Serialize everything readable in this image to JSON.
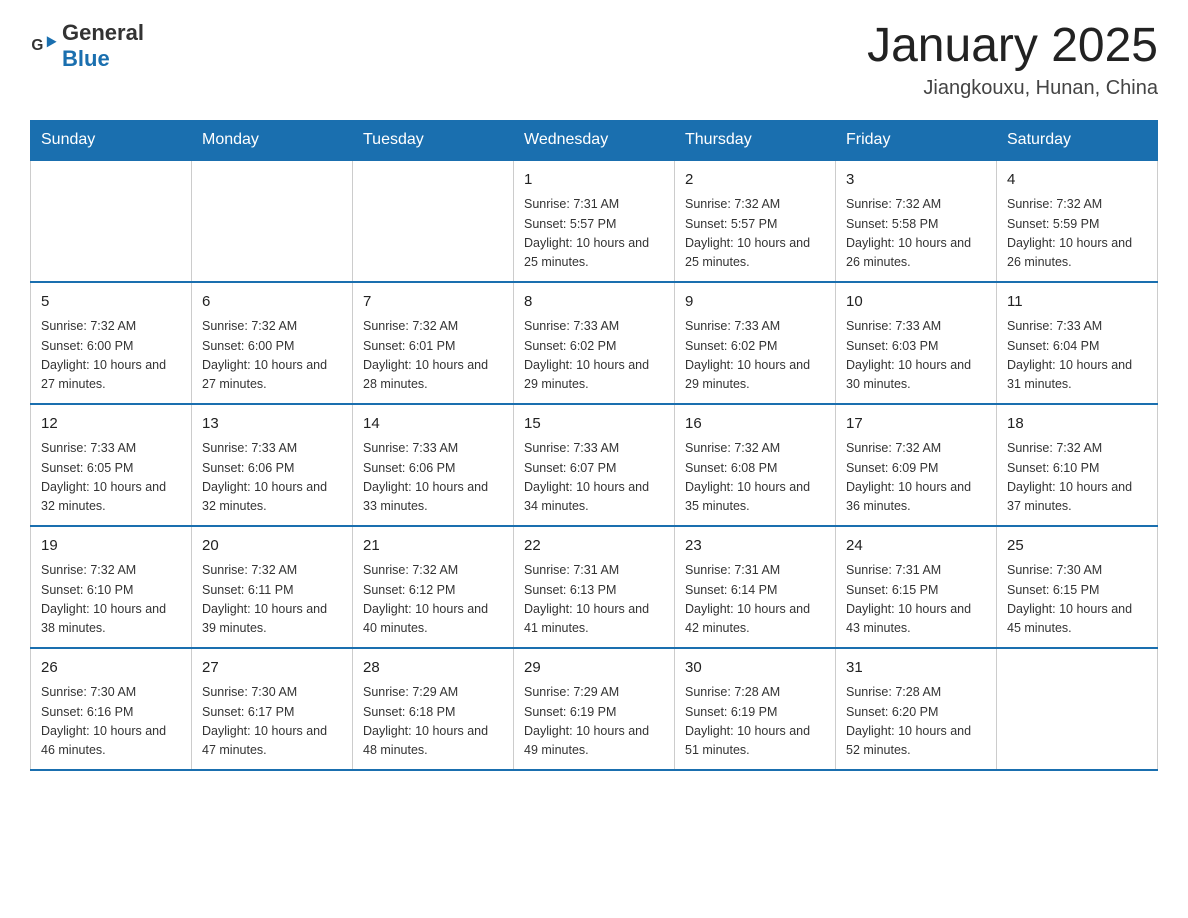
{
  "header": {
    "logo_general": "General",
    "logo_blue": "Blue",
    "month_title": "January 2025",
    "location": "Jiangkouxu, Hunan, China"
  },
  "days_of_week": [
    "Sunday",
    "Monday",
    "Tuesday",
    "Wednesday",
    "Thursday",
    "Friday",
    "Saturday"
  ],
  "weeks": [
    [
      {
        "day": "",
        "info": ""
      },
      {
        "day": "",
        "info": ""
      },
      {
        "day": "",
        "info": ""
      },
      {
        "day": "1",
        "info": "Sunrise: 7:31 AM\nSunset: 5:57 PM\nDaylight: 10 hours\nand 25 minutes."
      },
      {
        "day": "2",
        "info": "Sunrise: 7:32 AM\nSunset: 5:57 PM\nDaylight: 10 hours\nand 25 minutes."
      },
      {
        "day": "3",
        "info": "Sunrise: 7:32 AM\nSunset: 5:58 PM\nDaylight: 10 hours\nand 26 minutes."
      },
      {
        "day": "4",
        "info": "Sunrise: 7:32 AM\nSunset: 5:59 PM\nDaylight: 10 hours\nand 26 minutes."
      }
    ],
    [
      {
        "day": "5",
        "info": "Sunrise: 7:32 AM\nSunset: 6:00 PM\nDaylight: 10 hours\nand 27 minutes."
      },
      {
        "day": "6",
        "info": "Sunrise: 7:32 AM\nSunset: 6:00 PM\nDaylight: 10 hours\nand 27 minutes."
      },
      {
        "day": "7",
        "info": "Sunrise: 7:32 AM\nSunset: 6:01 PM\nDaylight: 10 hours\nand 28 minutes."
      },
      {
        "day": "8",
        "info": "Sunrise: 7:33 AM\nSunset: 6:02 PM\nDaylight: 10 hours\nand 29 minutes."
      },
      {
        "day": "9",
        "info": "Sunrise: 7:33 AM\nSunset: 6:02 PM\nDaylight: 10 hours\nand 29 minutes."
      },
      {
        "day": "10",
        "info": "Sunrise: 7:33 AM\nSunset: 6:03 PM\nDaylight: 10 hours\nand 30 minutes."
      },
      {
        "day": "11",
        "info": "Sunrise: 7:33 AM\nSunset: 6:04 PM\nDaylight: 10 hours\nand 31 minutes."
      }
    ],
    [
      {
        "day": "12",
        "info": "Sunrise: 7:33 AM\nSunset: 6:05 PM\nDaylight: 10 hours\nand 32 minutes."
      },
      {
        "day": "13",
        "info": "Sunrise: 7:33 AM\nSunset: 6:06 PM\nDaylight: 10 hours\nand 32 minutes."
      },
      {
        "day": "14",
        "info": "Sunrise: 7:33 AM\nSunset: 6:06 PM\nDaylight: 10 hours\nand 33 minutes."
      },
      {
        "day": "15",
        "info": "Sunrise: 7:33 AM\nSunset: 6:07 PM\nDaylight: 10 hours\nand 34 minutes."
      },
      {
        "day": "16",
        "info": "Sunrise: 7:32 AM\nSunset: 6:08 PM\nDaylight: 10 hours\nand 35 minutes."
      },
      {
        "day": "17",
        "info": "Sunrise: 7:32 AM\nSunset: 6:09 PM\nDaylight: 10 hours\nand 36 minutes."
      },
      {
        "day": "18",
        "info": "Sunrise: 7:32 AM\nSunset: 6:10 PM\nDaylight: 10 hours\nand 37 minutes."
      }
    ],
    [
      {
        "day": "19",
        "info": "Sunrise: 7:32 AM\nSunset: 6:10 PM\nDaylight: 10 hours\nand 38 minutes."
      },
      {
        "day": "20",
        "info": "Sunrise: 7:32 AM\nSunset: 6:11 PM\nDaylight: 10 hours\nand 39 minutes."
      },
      {
        "day": "21",
        "info": "Sunrise: 7:32 AM\nSunset: 6:12 PM\nDaylight: 10 hours\nand 40 minutes."
      },
      {
        "day": "22",
        "info": "Sunrise: 7:31 AM\nSunset: 6:13 PM\nDaylight: 10 hours\nand 41 minutes."
      },
      {
        "day": "23",
        "info": "Sunrise: 7:31 AM\nSunset: 6:14 PM\nDaylight: 10 hours\nand 42 minutes."
      },
      {
        "day": "24",
        "info": "Sunrise: 7:31 AM\nSunset: 6:15 PM\nDaylight: 10 hours\nand 43 minutes."
      },
      {
        "day": "25",
        "info": "Sunrise: 7:30 AM\nSunset: 6:15 PM\nDaylight: 10 hours\nand 45 minutes."
      }
    ],
    [
      {
        "day": "26",
        "info": "Sunrise: 7:30 AM\nSunset: 6:16 PM\nDaylight: 10 hours\nand 46 minutes."
      },
      {
        "day": "27",
        "info": "Sunrise: 7:30 AM\nSunset: 6:17 PM\nDaylight: 10 hours\nand 47 minutes."
      },
      {
        "day": "28",
        "info": "Sunrise: 7:29 AM\nSunset: 6:18 PM\nDaylight: 10 hours\nand 48 minutes."
      },
      {
        "day": "29",
        "info": "Sunrise: 7:29 AM\nSunset: 6:19 PM\nDaylight: 10 hours\nand 49 minutes."
      },
      {
        "day": "30",
        "info": "Sunrise: 7:28 AM\nSunset: 6:19 PM\nDaylight: 10 hours\nand 51 minutes."
      },
      {
        "day": "31",
        "info": "Sunrise: 7:28 AM\nSunset: 6:20 PM\nDaylight: 10 hours\nand 52 minutes."
      },
      {
        "day": "",
        "info": ""
      }
    ]
  ]
}
